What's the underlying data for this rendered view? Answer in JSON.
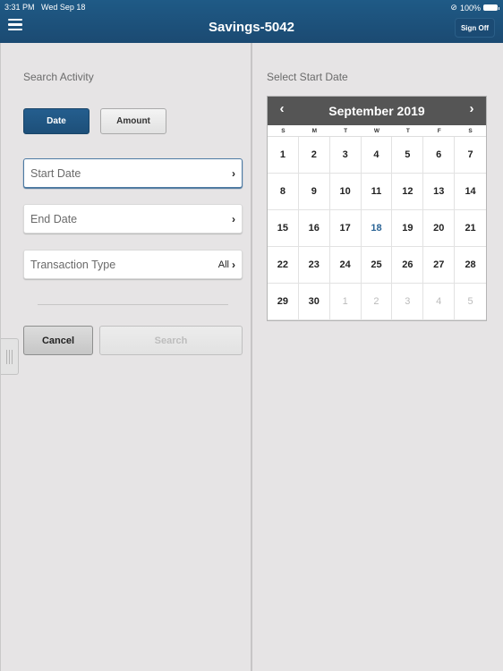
{
  "status_bar": {
    "time": "3:31 PM",
    "date": "Wed Sep 18",
    "battery": "100%"
  },
  "header": {
    "title": "Savings-5042",
    "sign_off": "Sign Off",
    "menu_icon": "hamburger-icon"
  },
  "search": {
    "heading": "Search Activity",
    "toggle": {
      "options": [
        "Date",
        "Amount"
      ],
      "selected": "Date"
    },
    "fields": {
      "start_date": "Start Date",
      "end_date": "End Date",
      "transaction_type": "Transaction Type",
      "transaction_type_value": "All"
    },
    "buttons": {
      "cancel": "Cancel",
      "search": "Search"
    }
  },
  "calendar": {
    "heading": "Select Start Date",
    "month_title": "September 2019",
    "prev_icon": "‹",
    "next_icon": "›",
    "weekdays": [
      "S",
      "M",
      "T",
      "W",
      "T",
      "F",
      "S"
    ],
    "today": 18,
    "days": [
      {
        "d": "1",
        "m": "cur"
      },
      {
        "d": "2",
        "m": "cur"
      },
      {
        "d": "3",
        "m": "cur"
      },
      {
        "d": "4",
        "m": "cur"
      },
      {
        "d": "5",
        "m": "cur"
      },
      {
        "d": "6",
        "m": "cur"
      },
      {
        "d": "7",
        "m": "cur"
      },
      {
        "d": "8",
        "m": "cur"
      },
      {
        "d": "9",
        "m": "cur"
      },
      {
        "d": "10",
        "m": "cur"
      },
      {
        "d": "11",
        "m": "cur"
      },
      {
        "d": "12",
        "m": "cur"
      },
      {
        "d": "13",
        "m": "cur"
      },
      {
        "d": "14",
        "m": "cur"
      },
      {
        "d": "15",
        "m": "cur"
      },
      {
        "d": "16",
        "m": "cur"
      },
      {
        "d": "17",
        "m": "cur"
      },
      {
        "d": "18",
        "m": "cur"
      },
      {
        "d": "19",
        "m": "cur"
      },
      {
        "d": "20",
        "m": "cur"
      },
      {
        "d": "21",
        "m": "cur"
      },
      {
        "d": "22",
        "m": "cur"
      },
      {
        "d": "23",
        "m": "cur"
      },
      {
        "d": "24",
        "m": "cur"
      },
      {
        "d": "25",
        "m": "cur"
      },
      {
        "d": "26",
        "m": "cur"
      },
      {
        "d": "27",
        "m": "cur"
      },
      {
        "d": "28",
        "m": "cur"
      },
      {
        "d": "29",
        "m": "cur"
      },
      {
        "d": "30",
        "m": "cur"
      },
      {
        "d": "1",
        "m": "next"
      },
      {
        "d": "2",
        "m": "next"
      },
      {
        "d": "3",
        "m": "next"
      },
      {
        "d": "4",
        "m": "next"
      },
      {
        "d": "5",
        "m": "next"
      }
    ]
  },
  "colors": {
    "header_bg": "#1f5a86",
    "accent": "#245e8e",
    "today": "#2a6496",
    "calendar_header": "#555555"
  }
}
